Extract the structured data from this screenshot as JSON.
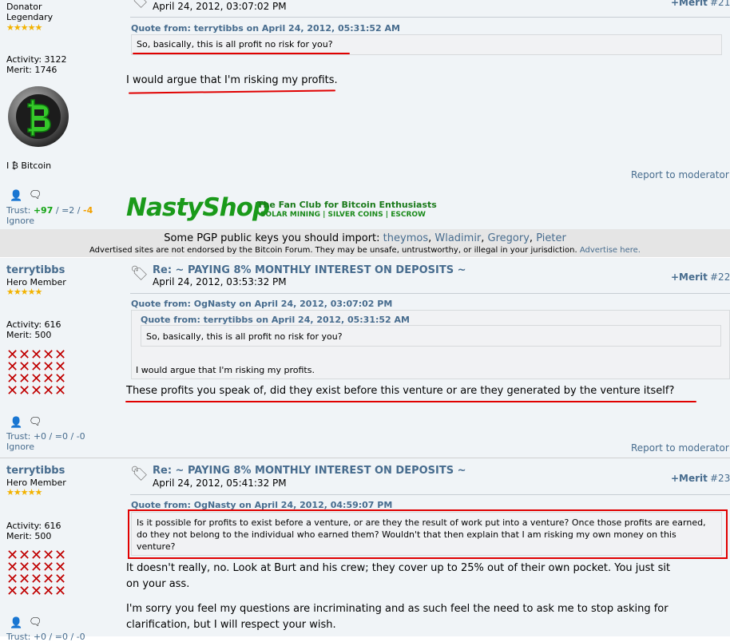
{
  "post1": {
    "rank1": "Donator",
    "rank2": "Legendary",
    "stars": "★★★★★",
    "activity": "Activity: 3122",
    "merit": "Merit: 1746",
    "signature": "I ₿ Bitcoin",
    "trust_prefix": "Trust: ",
    "trust_pos": "+97",
    "trust_mid": " / =2 / ",
    "trust_neg": "-4",
    "ignore": "Ignore",
    "date": "April 24, 2012, 03:07:02 PM",
    "merit_btn": "+Merit",
    "num": "#21",
    "quote_header": "Quote from: terrytibbs on April 24, 2012, 05:31:52 AM",
    "quote_text": "So, basically, this is all profit no risk for you?",
    "body": "I would argue that I'm risking my profits.",
    "report": "Report to moderator"
  },
  "ad": {
    "logo": "NastyShop",
    "tagline": "The Fan Club for Bitcoin Enthusiasts",
    "tags": "SOLAR MINING | SILVER COINS | ESCROW",
    "pgp_text": "Some PGP public keys you should import:",
    "pgp_keys": [
      "theymos",
      "Wladimir",
      "Gregory",
      "Pieter"
    ],
    "disclaimer": "Advertised sites are not endorsed by the Bitcoin Forum. They may be unsafe, untrustworthy, or illegal in your jurisdiction.",
    "advertise": "Advertise here."
  },
  "post2": {
    "username": "terrytibbs",
    "rank": "Hero Member",
    "stars": "★★★★★",
    "activity": "Activity: 616",
    "merit": "Merit: 500",
    "trust": "Trust: +0 / =0 / -0",
    "ignore": "Ignore",
    "subject": "Re: ~ PAYING 8% MONTHLY INTEREST ON DEPOSITS ~",
    "date": "April 24, 2012, 03:53:32 PM",
    "merit_btn": "+Merit",
    "num": "#22",
    "outer_quote_header": "Quote from: OgNasty on April 24, 2012, 03:07:02 PM",
    "inner_quote_header": "Quote from: terrytibbs on April 24, 2012, 05:31:52 AM",
    "inner_quote_text": "So, basically, this is all profit no risk for you?",
    "outer_quote_text": "I would argue that I'm risking my profits.",
    "body": "These profits you speak of, did they exist before this venture or are they generated by the venture itself?",
    "report": "Report to moderator"
  },
  "post3": {
    "username": "terrytibbs",
    "rank": "Hero Member",
    "stars": "★★★★★",
    "activity": "Activity: 616",
    "merit": "Merit: 500",
    "subject": "Re: ~ PAYING 8% MONTHLY INTEREST ON DEPOSITS ~",
    "date": "April 24, 2012, 05:41:32 PM",
    "merit_btn": "+Merit",
    "num": "#23",
    "quote_header": "Quote from: OgNasty on April 24, 2012, 04:59:07 PM",
    "quote_text": "Is it possible for profits to exist before a venture, or are they the result of work put into a venture? Once those profits are earned, do they not belong to the individual who earned them? Wouldn't that then explain that I am risking my own money on this venture?",
    "body1": "It doesn't really, no. Look at Burt and his crew; they cover up to 25% out of their own pocket. You just sit on your ass.",
    "body2": "I'm sorry you feel my questions are incriminating and as such feel the need to ask me to stop asking for clarification, but I will respect your wish.",
    "trust": "Trust: +0 / =0 / -0"
  },
  "colors": {
    "accent": "#476c8e",
    "highlight": "#e00000",
    "post_bg": "#f0f4f7"
  }
}
